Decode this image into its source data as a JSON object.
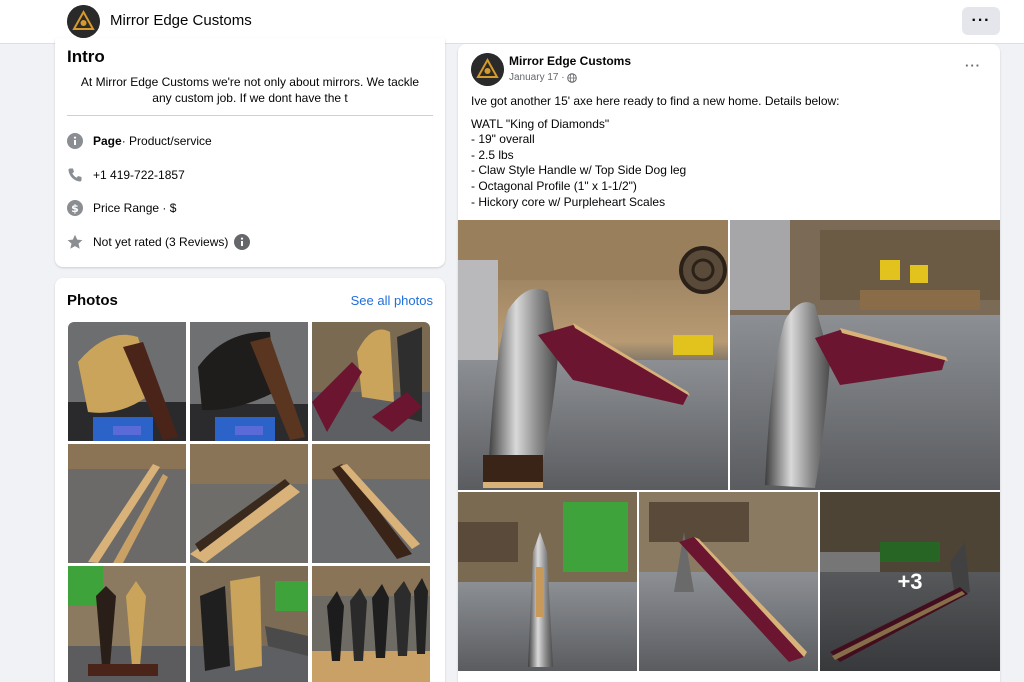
{
  "header": {
    "page_name": "Mirror Edge Customs",
    "more_label": "···"
  },
  "intro": {
    "title": "Intro",
    "bio": "At Mirror Edge Customs we're not only about mirrors. We tackle any custom job. If we dont have the t",
    "category_label": "Page",
    "category_value": " · Product/service",
    "phone": "+1 419-722-1857",
    "price_range": "Price Range · $",
    "rating": "Not yet rated (3 Reviews)",
    "icons": [
      "info-icon",
      "phone-icon",
      "dollar-icon",
      "star-icon",
      "info-icon"
    ]
  },
  "photos": {
    "title": "Photos",
    "see_all": "See all photos",
    "count": 9
  },
  "post": {
    "author": "Mirror Edge Customs",
    "date": "January 17 · ",
    "privacy_icon": "globe-icon",
    "more_label": "···",
    "text_lines": [
      "Ive got another 15' axe here ready to find a new home. Details below:",
      "",
      "WATL \"King of Diamonds\"",
      "- 19\" overall",
      "- 2.5 lbs",
      "- Claw Style Handle w/ Top Side Dog leg",
      "- Octagonal Profile (1\" x 1-1/2\")",
      "- Hickory core w/ Purpleheart Scales"
    ],
    "more_photos_label": "+3"
  },
  "colors": {
    "accent": "#216fdb",
    "background": "#f0f2f5",
    "purpleheart": "#6b1530",
    "hickory": "#d9b27a"
  }
}
